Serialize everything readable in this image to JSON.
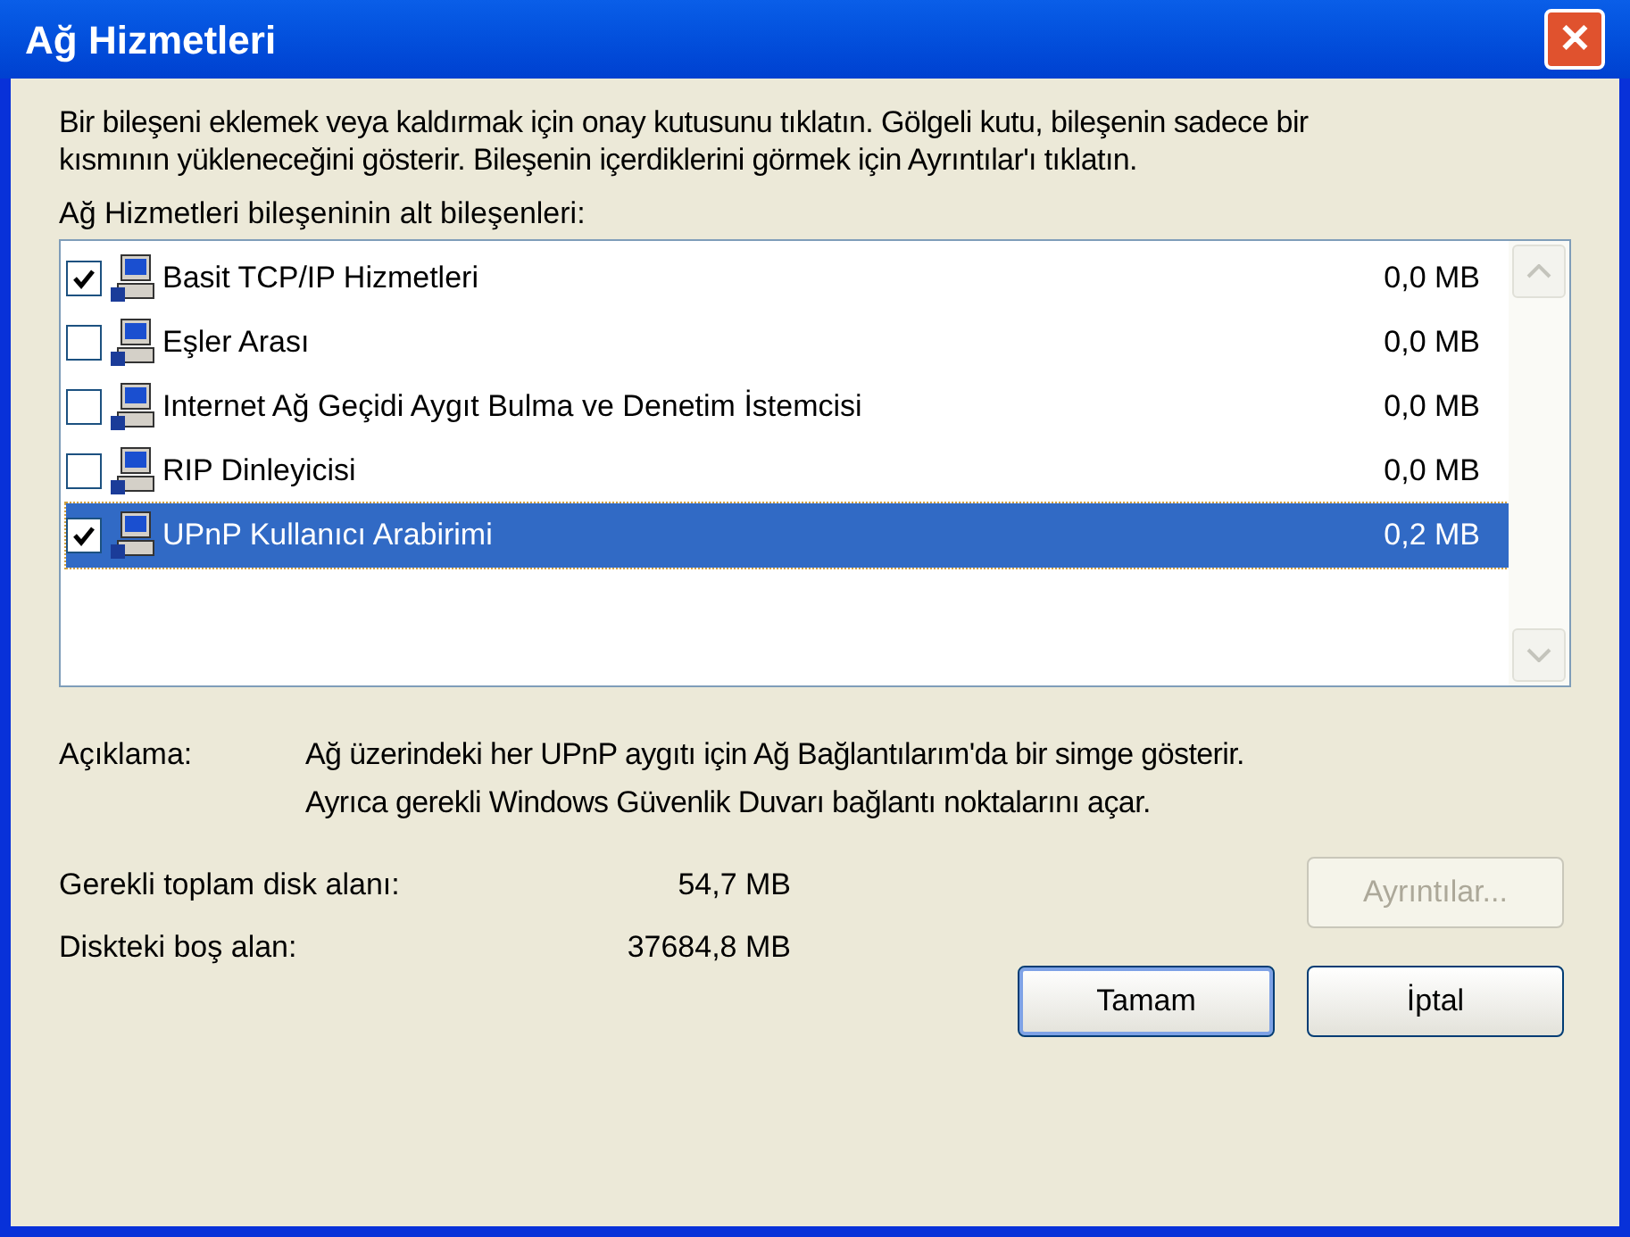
{
  "window": {
    "title": "Ağ Hizmetleri",
    "close": "✕"
  },
  "instructions": "Bir bileşeni eklemek veya kaldırmak için onay kutusunu tıklatın. Gölgeli kutu, bileşenin sadece bir kısmının yükleneceğini gösterir. Bileşenin içerdiklerini görmek için Ayrıntılar'ı tıklatın.",
  "list_label": "Ağ Hizmetleri bileşeninin alt bileşenleri:",
  "components": [
    {
      "name": "Basit TCP/IP Hizmetleri",
      "size": "0,0 MB",
      "checked": true,
      "selected": false
    },
    {
      "name": "Eşler Arası",
      "size": "0,0 MB",
      "checked": false,
      "selected": false
    },
    {
      "name": "Internet Ağ Geçidi Aygıt Bulma ve Denetim İstemcisi",
      "size": "0,0 MB",
      "checked": false,
      "selected": false
    },
    {
      "name": "RIP Dinleyicisi",
      "size": "0,0 MB",
      "checked": false,
      "selected": false
    },
    {
      "name": "UPnP Kullanıcı Arabirimi",
      "size": "0,2 MB",
      "checked": true,
      "selected": true
    }
  ],
  "description": {
    "label": "Açıklama:",
    "text": "Ağ üzerindeki her UPnP aygıtı için Ağ Bağlantılarım'da bir simge gösterir. Ayrıca gerekli Windows Güvenlik Duvarı bağlantı noktalarını açar."
  },
  "disk": [
    {
      "label": "Gerekli toplam disk alanı:",
      "value": "54,7 MB"
    },
    {
      "label": "Diskteki boş alan:",
      "value": "37684,8 MB"
    }
  ],
  "buttons": [
    {
      "label": "Ayrıntılar...",
      "disabled": true,
      "default": false
    },
    {
      "label": "Tamam",
      "disabled": false,
      "default": true
    },
    {
      "label": "İptal",
      "disabled": false,
      "default": false
    }
  ]
}
